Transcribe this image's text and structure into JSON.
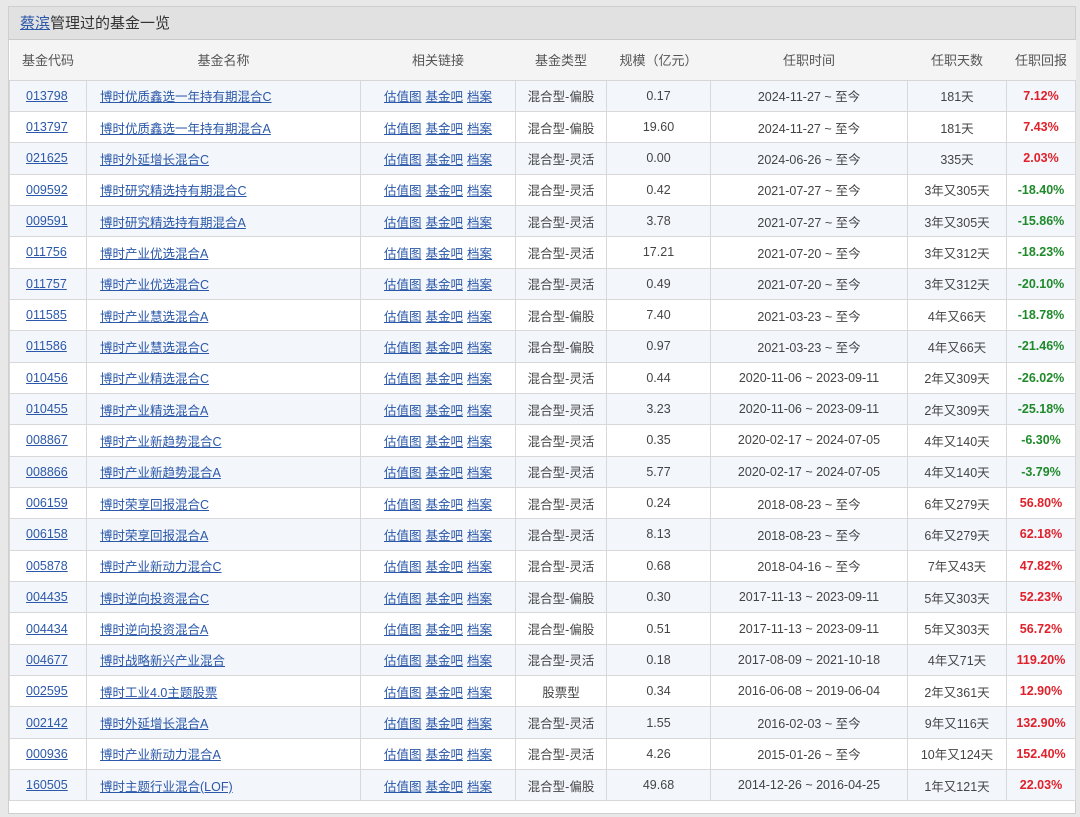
{
  "header": {
    "manager_name": "蔡滨",
    "title_suffix": "管理过的基金一览"
  },
  "columns": [
    "基金代码",
    "基金名称",
    "相关链接",
    "基金类型",
    "规模（亿元）",
    "任职时间",
    "任职天数",
    "任职回报"
  ],
  "link_labels": [
    "估值图",
    "基金吧",
    "档案"
  ],
  "colors": {
    "link": "#2b58a8",
    "positive": "#e0202a",
    "negative": "#1f8a2a",
    "row_alt": "#f3f6fb"
  },
  "funds": [
    {
      "code": "013798",
      "name": "博时优质鑫选一年持有期混合C",
      "type": "混合型-偏股",
      "size": "0.17",
      "period": "2024-11-27 ~ 至今",
      "days": "181天",
      "ret": "7.12%",
      "dir": "up"
    },
    {
      "code": "013797",
      "name": "博时优质鑫选一年持有期混合A",
      "type": "混合型-偏股",
      "size": "19.60",
      "period": "2024-11-27 ~ 至今",
      "days": "181天",
      "ret": "7.43%",
      "dir": "up"
    },
    {
      "code": "021625",
      "name": "博时外延增长混合C",
      "type": "混合型-灵活",
      "size": "0.00",
      "period": "2024-06-26 ~ 至今",
      "days": "335天",
      "ret": "2.03%",
      "dir": "up"
    },
    {
      "code": "009592",
      "name": "博时研究精选持有期混合C",
      "type": "混合型-灵活",
      "size": "0.42",
      "period": "2021-07-27 ~ 至今",
      "days": "3年又305天",
      "ret": "-18.40%",
      "dir": "down"
    },
    {
      "code": "009591",
      "name": "博时研究精选持有期混合A",
      "type": "混合型-灵活",
      "size": "3.78",
      "period": "2021-07-27 ~ 至今",
      "days": "3年又305天",
      "ret": "-15.86%",
      "dir": "down"
    },
    {
      "code": "011756",
      "name": "博时产业优选混合A",
      "type": "混合型-灵活",
      "size": "17.21",
      "period": "2021-07-20 ~ 至今",
      "days": "3年又312天",
      "ret": "-18.23%",
      "dir": "down"
    },
    {
      "code": "011757",
      "name": "博时产业优选混合C",
      "type": "混合型-灵活",
      "size": "0.49",
      "period": "2021-07-20 ~ 至今",
      "days": "3年又312天",
      "ret": "-20.10%",
      "dir": "down"
    },
    {
      "code": "011585",
      "name": "博时产业慧选混合A",
      "type": "混合型-偏股",
      "size": "7.40",
      "period": "2021-03-23 ~ 至今",
      "days": "4年又66天",
      "ret": "-18.78%",
      "dir": "down"
    },
    {
      "code": "011586",
      "name": "博时产业慧选混合C",
      "type": "混合型-偏股",
      "size": "0.97",
      "period": "2021-03-23 ~ 至今",
      "days": "4年又66天",
      "ret": "-21.46%",
      "dir": "down"
    },
    {
      "code": "010456",
      "name": "博时产业精选混合C",
      "type": "混合型-灵活",
      "size": "0.44",
      "period": "2020-11-06 ~ 2023-09-11",
      "days": "2年又309天",
      "ret": "-26.02%",
      "dir": "down"
    },
    {
      "code": "010455",
      "name": "博时产业精选混合A",
      "type": "混合型-灵活",
      "size": "3.23",
      "period": "2020-11-06 ~ 2023-09-11",
      "days": "2年又309天",
      "ret": "-25.18%",
      "dir": "down"
    },
    {
      "code": "008867",
      "name": "博时产业新趋势混合C",
      "type": "混合型-灵活",
      "size": "0.35",
      "period": "2020-02-17 ~ 2024-07-05",
      "days": "4年又140天",
      "ret": "-6.30%",
      "dir": "down"
    },
    {
      "code": "008866",
      "name": "博时产业新趋势混合A",
      "type": "混合型-灵活",
      "size": "5.77",
      "period": "2020-02-17 ~ 2024-07-05",
      "days": "4年又140天",
      "ret": "-3.79%",
      "dir": "down"
    },
    {
      "code": "006159",
      "name": "博时荣享回报混合C",
      "type": "混合型-灵活",
      "size": "0.24",
      "period": "2018-08-23 ~ 至今",
      "days": "6年又279天",
      "ret": "56.80%",
      "dir": "up"
    },
    {
      "code": "006158",
      "name": "博时荣享回报混合A",
      "type": "混合型-灵活",
      "size": "8.13",
      "period": "2018-08-23 ~ 至今",
      "days": "6年又279天",
      "ret": "62.18%",
      "dir": "up"
    },
    {
      "code": "005878",
      "name": "博时产业新动力混合C",
      "type": "混合型-灵活",
      "size": "0.68",
      "period": "2018-04-16 ~ 至今",
      "days": "7年又43天",
      "ret": "47.82%",
      "dir": "up"
    },
    {
      "code": "004435",
      "name": "博时逆向投资混合C",
      "type": "混合型-偏股",
      "size": "0.30",
      "period": "2017-11-13 ~ 2023-09-11",
      "days": "5年又303天",
      "ret": "52.23%",
      "dir": "up"
    },
    {
      "code": "004434",
      "name": "博时逆向投资混合A",
      "type": "混合型-偏股",
      "size": "0.51",
      "period": "2017-11-13 ~ 2023-09-11",
      "days": "5年又303天",
      "ret": "56.72%",
      "dir": "up"
    },
    {
      "code": "004677",
      "name": "博时战略新兴产业混合",
      "type": "混合型-灵活",
      "size": "0.18",
      "period": "2017-08-09 ~ 2021-10-18",
      "days": "4年又71天",
      "ret": "119.20%",
      "dir": "up"
    },
    {
      "code": "002595",
      "name": "博时工业4.0主题股票",
      "type": "股票型",
      "size": "0.34",
      "period": "2016-06-08 ~ 2019-06-04",
      "days": "2年又361天",
      "ret": "12.90%",
      "dir": "up"
    },
    {
      "code": "002142",
      "name": "博时外延增长混合A",
      "type": "混合型-灵活",
      "size": "1.55",
      "period": "2016-02-03 ~ 至今",
      "days": "9年又116天",
      "ret": "132.90%",
      "dir": "up"
    },
    {
      "code": "000936",
      "name": "博时产业新动力混合A",
      "type": "混合型-灵活",
      "size": "4.26",
      "period": "2015-01-26 ~ 至今",
      "days": "10年又124天",
      "ret": "152.40%",
      "dir": "up"
    },
    {
      "code": "160505",
      "name": "博时主题行业混合(LOF)",
      "type": "混合型-偏股",
      "size": "49.68",
      "period": "2014-12-26 ~ 2016-04-25",
      "days": "1年又121天",
      "ret": "22.03%",
      "dir": "up"
    }
  ]
}
